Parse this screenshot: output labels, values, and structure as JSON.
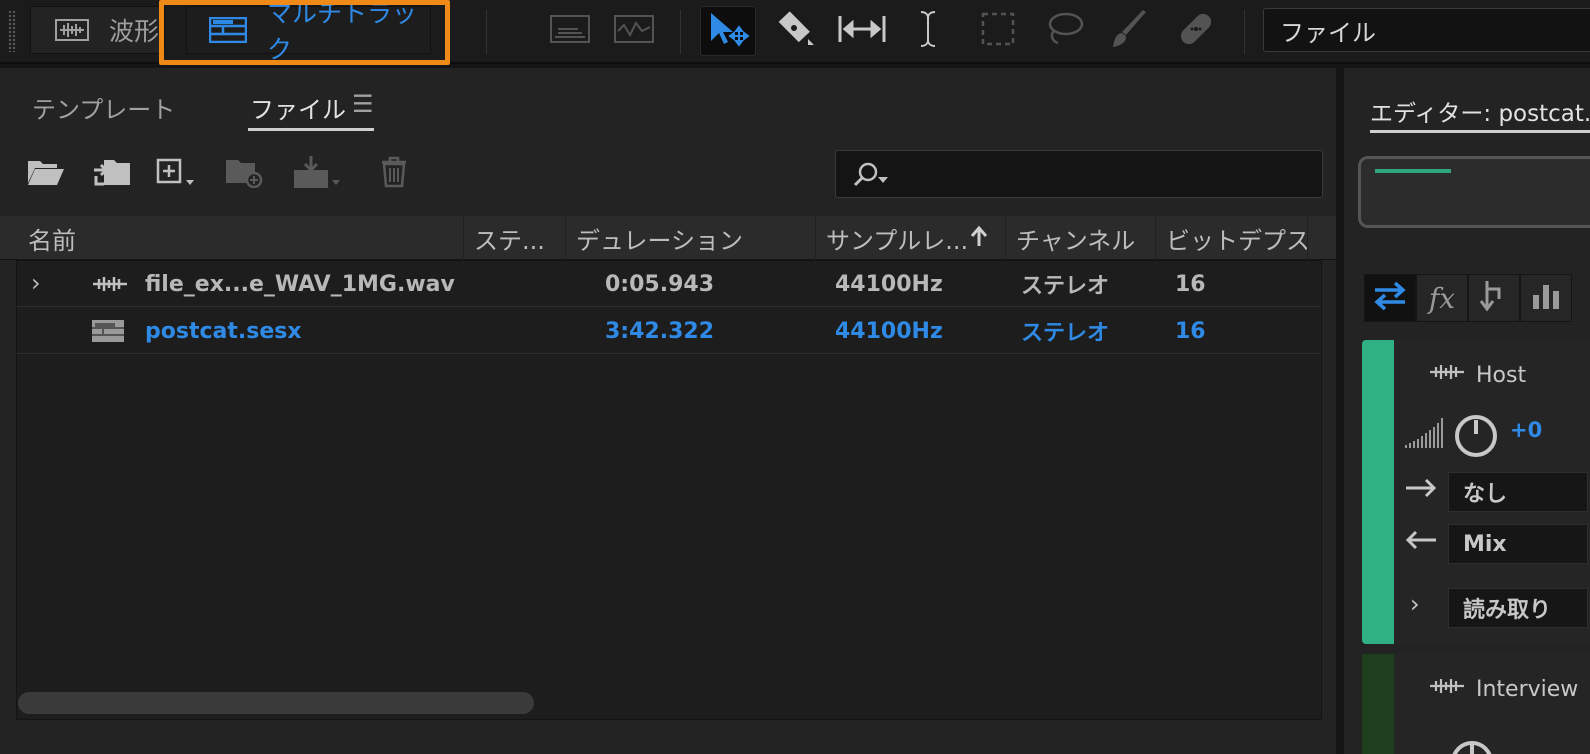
{
  "toolbar": {
    "tabs": [
      {
        "label": "波形",
        "icon": "waveform-icon"
      },
      {
        "label": "マルチトラック",
        "icon": "multitrack-icon"
      }
    ],
    "tools": [
      "spectral-frequency-icon",
      "spectral-pitch-icon",
      "move-tool-icon",
      "razor-tool-icon",
      "slip-tool-icon",
      "time-selection-icon",
      "marquee-icon",
      "lasso-icon",
      "brush-icon",
      "spot-healing-icon"
    ],
    "workspace_label": "ファイル"
  },
  "files_panel": {
    "tabs": [
      "テンプレート",
      "ファイル"
    ],
    "menu_glyph": "☰",
    "search": {
      "placeholder": ""
    },
    "columns": [
      "名前",
      "ステ...",
      "デュレーション",
      "サンプルレ...",
      "チャンネル",
      "ビットデプス"
    ],
    "rows": [
      {
        "name": "file_ex...e_WAV_1MG.wav",
        "status": "",
        "duration": "0:05.943",
        "sample_rate": "44100Hz",
        "channels": "ステレオ",
        "bit_depth": "16",
        "selected": false
      },
      {
        "name": "postcat.sesx",
        "status": "",
        "duration": "3:42.322",
        "sample_rate": "44100Hz",
        "channels": "ステレオ",
        "bit_depth": "16",
        "selected": true
      }
    ]
  },
  "editor_panel": {
    "title": "エディター: postcat.sesx",
    "tracks": [
      {
        "name": "Host",
        "volume": "+0",
        "input": "なし",
        "output": "Mix",
        "automation": "読み取り"
      },
      {
        "name": "Interview"
      }
    ]
  },
  "colors": {
    "accent": "#2f8ae6",
    "highlight": "#ef8a18",
    "track_green": "#2fb184"
  }
}
